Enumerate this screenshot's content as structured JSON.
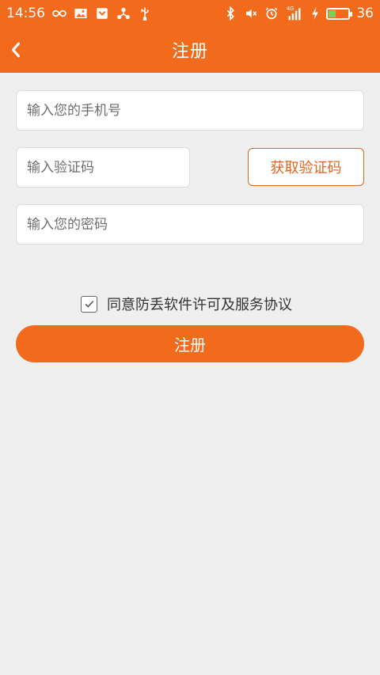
{
  "status_bar": {
    "time": "14:56",
    "battery_level": "36",
    "battery_fill_fraction": 0.36,
    "left_icons": [
      "infinity-icon",
      "image-icon",
      "pocket-icon",
      "share-network-icon",
      "usb-icon"
    ],
    "right_icons": [
      "bluetooth-icon",
      "mute-icon",
      "alarm-icon",
      "signal-4g-icon",
      "charging-icon",
      "battery-icon"
    ],
    "network_label": "4G"
  },
  "app_bar": {
    "title": "注册",
    "back_icon": "chevron-left-icon"
  },
  "form": {
    "phone_placeholder": "输入您的手机号",
    "code_placeholder": "输入验证码",
    "get_code_label": "获取验证码",
    "password_placeholder": "输入您的密码",
    "agree_label": "同意防丢软件许可及服务协议",
    "agree_checked": true,
    "register_label": "注册"
  },
  "colors": {
    "accent": "#f26a1b",
    "background": "#efefef",
    "battery_fill": "#7ad15a"
  }
}
